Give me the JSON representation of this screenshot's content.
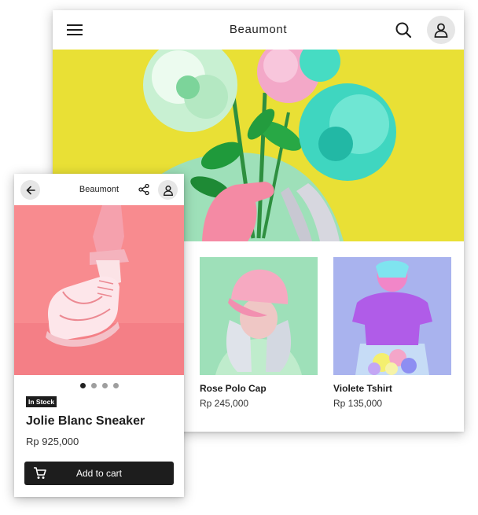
{
  "desktop": {
    "brand": "Beaumont",
    "icons": {
      "menu": "hamburger-menu-icon",
      "search": "search-icon",
      "account": "user-icon"
    },
    "products": [
      {
        "name": "Rose Polo Cap",
        "price": "Rp 245,000"
      },
      {
        "name": "Violete Tshirt",
        "price": "Rp 135,000"
      }
    ]
  },
  "mobile": {
    "brand": "Beaumont",
    "icons": {
      "back": "arrow-left-icon",
      "share": "share-icon",
      "account": "user-icon",
      "cart": "shopping-cart-icon"
    },
    "badge": "In Stock",
    "product_name": "Jolie Blanc Sneaker",
    "price": "Rp 925,000",
    "add_to_cart": "Add to cart",
    "carousel": {
      "total": 4,
      "active_index": 0
    }
  },
  "colors": {
    "hero_bg": "#e9e035",
    "mint": "#9ee0b9",
    "lavender": "#a9b3ee",
    "coral": "#f88b8f",
    "button_dark": "#1d1d1d"
  }
}
